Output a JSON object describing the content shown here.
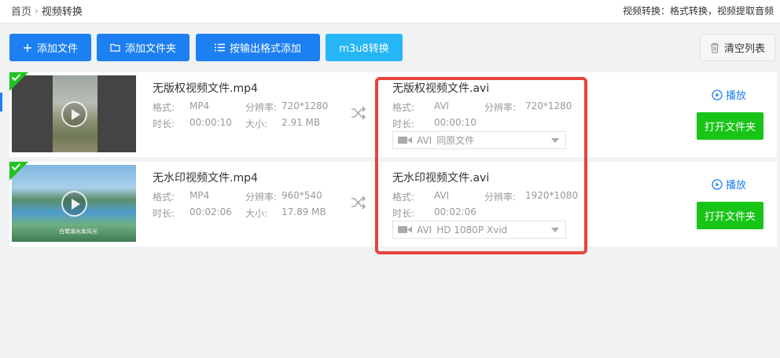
{
  "breadcrumb": {
    "home": "首页",
    "separator": "›",
    "current": "视频转换"
  },
  "top_right_text": "视频转换：格式转换，视频提取音频",
  "toolbar": {
    "add_file": "添加文件",
    "add_folder": "添加文件夹",
    "add_by_format": "按输出格式添加",
    "m3u8": "m3u8转换",
    "clear": "清空列表"
  },
  "labels": {
    "format": "格式:",
    "resolution": "分辨率:",
    "duration": "时长:",
    "size": "大小:",
    "play": "播放",
    "open_folder": "打开文件夹"
  },
  "files": [
    {
      "source": {
        "name": "无版权视频文件.mp4",
        "format": "MP4",
        "resolution": "720*1280",
        "duration": "00:00:10",
        "size": "2.91 MB"
      },
      "output": {
        "name": "无版权视频文件.avi",
        "format": "AVI",
        "resolution": "720*1280",
        "duration": "00:00:10",
        "select_format": "AVI",
        "select_quality": "同原文件"
      }
    },
    {
      "source": {
        "name": "无水印视频文件.mp4",
        "format": "MP4",
        "resolution": "960*540",
        "duration": "00:02:06",
        "size": "17.89 MB"
      },
      "output": {
        "name": "无水印视频文件.avi",
        "format": "AVI",
        "resolution": "1920*1080",
        "duration": "00:02:06",
        "select_format": "AVI",
        "select_quality": "HD 1080P Xvid"
      },
      "thumb_caption": "白鹭湖水库风光"
    }
  ],
  "colors": {
    "primary": "#1c7ff2",
    "light_blue": "#26b6f5",
    "green": "#19c419",
    "highlight": "#e7443a"
  }
}
